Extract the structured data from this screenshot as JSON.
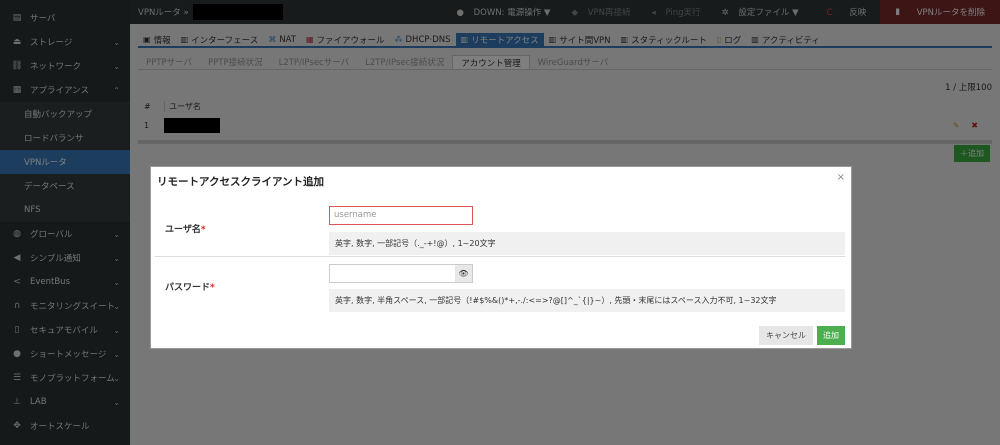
{
  "sidebar": {
    "items": [
      {
        "label": "サーバ",
        "icon": "server-icon"
      },
      {
        "label": "ストレージ",
        "icon": "storage-icon"
      },
      {
        "label": "ネットワーク",
        "icon": "network-icon"
      },
      {
        "label": "アプライアンス",
        "icon": "appliance-icon"
      },
      {
        "label": "自動バックアップ"
      },
      {
        "label": "ロードバランサ"
      },
      {
        "label": "VPNルータ"
      },
      {
        "label": "データベース"
      },
      {
        "label": "NFS"
      },
      {
        "label": "グローバル",
        "icon": "globe-icon"
      },
      {
        "label": "シンプル通知",
        "icon": "megaphone-icon"
      },
      {
        "label": "EventBus",
        "icon": "share-icon"
      },
      {
        "label": "モニタリングスイート",
        "icon": "binoculars-icon"
      },
      {
        "label": "セキュアモバイル",
        "icon": "mobile-icon"
      },
      {
        "label": "ショートメッセージ",
        "icon": "chat-icon"
      },
      {
        "label": "モノプラットフォーム",
        "icon": "bars-icon"
      },
      {
        "label": "LAB",
        "icon": "flask-icon"
      },
      {
        "label": "オートスケール",
        "icon": "arrows-icon"
      }
    ]
  },
  "topbar": {
    "breadcrumb": "VPNルータ »",
    "status": "DOWN: 電源操作 ▼",
    "reconnect": "VPN再接続",
    "ping": "Ping実行",
    "config": "設定ファイル ▼",
    "apply": "反映",
    "delete": "VPNルータを削除"
  },
  "tabs": [
    "情報",
    "インターフェース",
    "NAT",
    "ファイアウォール",
    "DHCP·DNS",
    "リモートアクセス",
    "サイト間VPN",
    "スタティックルート",
    "ログ",
    "アクティビティ"
  ],
  "subtabs": [
    "PPTPサーバ",
    "PPTP接続状況",
    "L2TP/IPsecサーバ",
    "L2TP/IPsec接続状況",
    "アカウント管理",
    "WireGuardサーバ"
  ],
  "table": {
    "count": "1 / 上限100",
    "headers": [
      "#",
      "ユーザ名"
    ],
    "rows": [
      {
        "num": "1"
      }
    ],
    "add": "追加"
  },
  "modal": {
    "title": "リモートアクセスクライアント追加",
    "close": "×",
    "username_label": "ユーザ名",
    "username_placeholder": "username",
    "username_help": "英字, 数字, 一部記号（._-+!@）, 1~20文字",
    "password_label": "パスワード",
    "password_help": "英字, 数字, 半角スペース, 一部記号（!#$%&()*+,-./:<=>?@[]^_`{|}~）, 先頭・末尾にはスペース入力不可, 1~32文字",
    "required": "*",
    "cancel": "キャンセル",
    "submit": "追加"
  }
}
